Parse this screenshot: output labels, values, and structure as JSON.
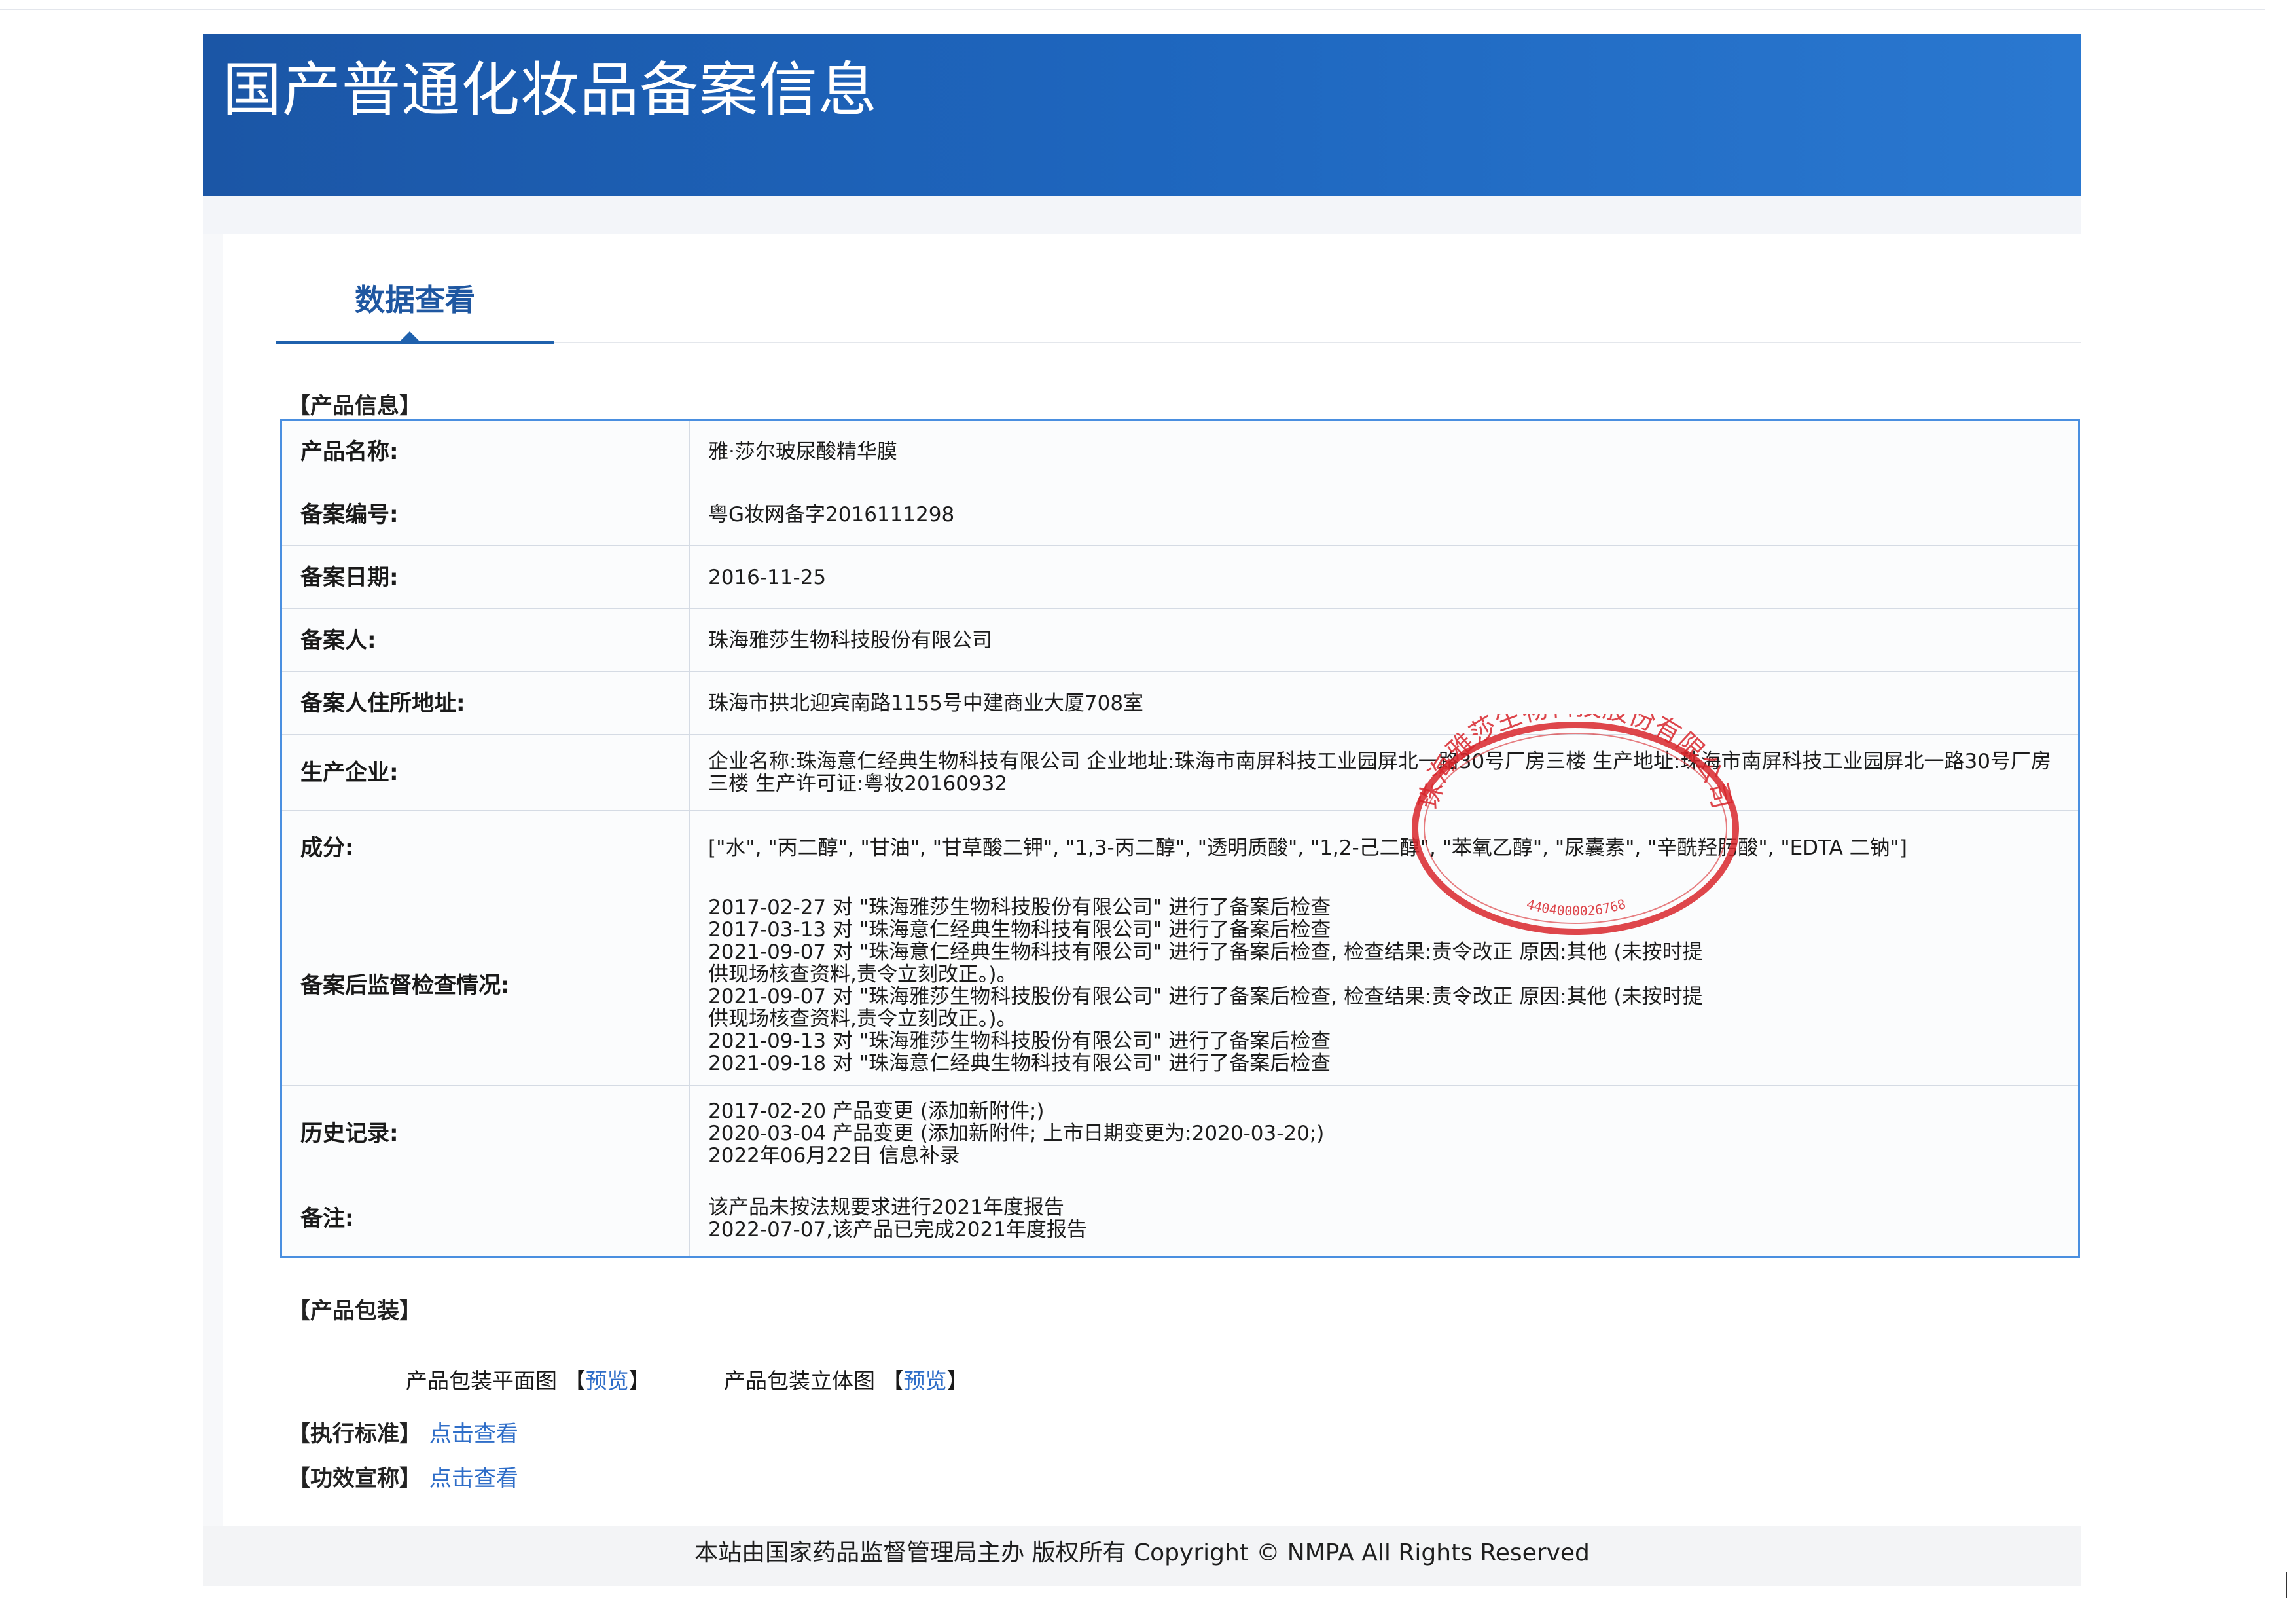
{
  "banner": {
    "title": "国产普通化妆品备案信息"
  },
  "tabs": [
    {
      "label": "数据查看"
    }
  ],
  "product_info": {
    "section_label": "【产品信息】",
    "rows": [
      {
        "key": "产品名称:",
        "value": "雅·莎尔玻尿酸精华膜"
      },
      {
        "key": "备案编号:",
        "value": "粤G妆网备字2016111298"
      },
      {
        "key": "备案日期:",
        "value": "2016-11-25"
      },
      {
        "key": "备案人:",
        "value": "珠海雅莎生物科技股份有限公司"
      },
      {
        "key": "备案人住所地址:",
        "value": "珠海市拱北迎宾南路1155号中建商业大厦708室"
      },
      {
        "key": "生产企业:",
        "value": "企业名称:珠海意仁经典生物科技有限公司 企业地址:珠海市南屏科技工业园屏北一路30号厂房三楼 生产地址:珠海市南屏科技工业园屏北一路30号厂房三楼 生产许可证:粤妆20160932"
      },
      {
        "key": "成分:",
        "value": "[\"水\", \"丙二醇\", \"甘油\", \"甘草酸二钾\", \"1,3-丙二醇\", \"透明质酸\", \"1,2-己二醇\", \"苯氧乙醇\", \"尿囊素\", \"辛酰羟肟酸\", \"EDTA 二钠\"]"
      },
      {
        "key": "备案后监督检查情况:",
        "value": "2017-02-27 对 \"珠海雅莎生物科技股份有限公司\" 进行了备案后检查\n2017-03-13 对 \"珠海意仁经典生物科技有限公司\" 进行了备案后检查\n2021-09-07 对 \"珠海意仁经典生物科技有限公司\" 进行了备案后检查, 检查结果:责令改正 原因:其他 (未按时提\n供现场核查资料,责令立刻改正。)。\n2021-09-07 对 \"珠海雅莎生物科技股份有限公司\" 进行了备案后检查, 检查结果:责令改正 原因:其他 (未按时提\n供现场核查资料,责令立刻改正。)。\n2021-09-13 对 \"珠海雅莎生物科技股份有限公司\" 进行了备案后检查\n2021-09-18 对 \"珠海意仁经典生物科技有限公司\" 进行了备案后检查"
      },
      {
        "key": "历史记录:",
        "value": "2017-02-20 产品变更 (添加新附件;)\n2020-03-04 产品变更 (添加新附件; 上市日期变更为:2020-03-20;)\n2022年06月22日 信息补录"
      },
      {
        "key": "备注:",
        "value": "该产品未按法规要求进行2021年度报告\n2022-07-07,该产品已完成2021年度报告"
      }
    ]
  },
  "seal": {
    "text": "珠海雅莎生物科技股份有限公司",
    "number": "4404000026768",
    "color": "#d8262c"
  },
  "packaging": {
    "section_label": "【产品包装】",
    "flat_label": "产品包装平面图",
    "flat_link": "预览",
    "stereo_label": "产品包装立体图",
    "stereo_link": "预览",
    "open_bracket": "【",
    "close_bracket": "】"
  },
  "standard": {
    "label": "【执行标准】",
    "link": "点击查看"
  },
  "efficacy": {
    "label": "【功效宣称】",
    "link": "点击查看"
  },
  "footer": {
    "text": "本站由国家药品监督管理局主办 版权所有 Copyright © NMPA All Rights Reserved"
  },
  "colors": {
    "banner": "#1e66be",
    "accent": "#1f61ad",
    "link": "#2f6ec8",
    "table_border": "#4a8fe0"
  }
}
